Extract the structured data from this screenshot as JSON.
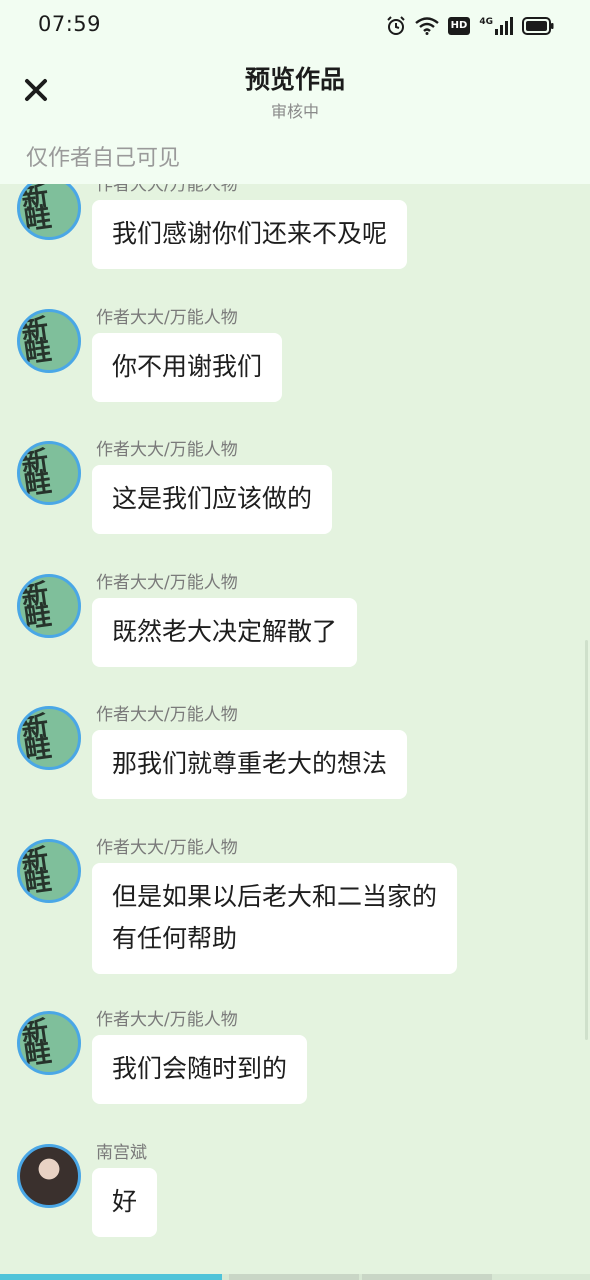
{
  "status_bar": {
    "time": "07:59",
    "icons": [
      "alarm-icon",
      "wifi-icon",
      "hd-icon",
      "signal-4g-icon",
      "battery-icon"
    ],
    "hd_label": "HD",
    "net_label": "4G"
  },
  "header": {
    "title": "预览作品",
    "subtitle": "审核中",
    "visibility_note": "仅作者自己可见",
    "close_icon": "close-icon"
  },
  "avatar_glyph": "新\n畦",
  "messages": [
    {
      "sender": "作者大大/万能人物",
      "text": "我们感谢你们还来不及呢",
      "avatar": "drawing"
    },
    {
      "sender": "作者大大/万能人物",
      "text": "你不用谢我们",
      "avatar": "drawing"
    },
    {
      "sender": "作者大大/万能人物",
      "text": "这是我们应该做的",
      "avatar": "drawing"
    },
    {
      "sender": "作者大大/万能人物",
      "text": "既然老大决定解散了",
      "avatar": "drawing"
    },
    {
      "sender": "作者大大/万能人物",
      "text": "那我们就尊重老大的想法",
      "avatar": "drawing"
    },
    {
      "sender": "作者大大/万能人物",
      "text": "但是如果以后老大和二当家的有任何帮助",
      "avatar": "drawing"
    },
    {
      "sender": "作者大大/万能人物",
      "text": "我们会随时到的",
      "avatar": "drawing"
    },
    {
      "sender": "南宫斌",
      "text": "好",
      "avatar": "photo"
    }
  ],
  "colors": {
    "background": "#e4f3df",
    "header_bg": "#f2fdf2",
    "bubble": "#ffffff",
    "avatar_ring": "#4aa7e6",
    "progress_accent": "#4fc3d9"
  }
}
